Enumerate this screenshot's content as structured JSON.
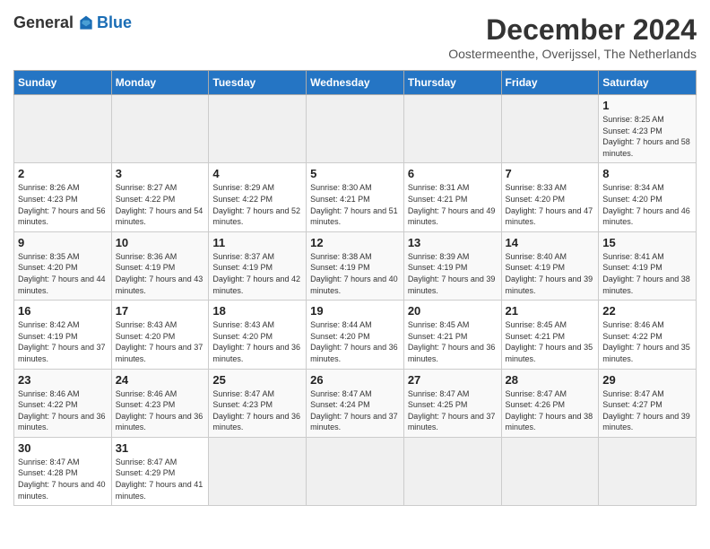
{
  "header": {
    "logo": {
      "general": "General",
      "blue": "Blue"
    },
    "title": "December 2024",
    "location": "Oostermeenthe, Overijssel, The Netherlands"
  },
  "calendar": {
    "days_of_week": [
      "Sunday",
      "Monday",
      "Tuesday",
      "Wednesday",
      "Thursday",
      "Friday",
      "Saturday"
    ],
    "weeks": [
      [
        {
          "day": "",
          "empty": true
        },
        {
          "day": "",
          "empty": true
        },
        {
          "day": "",
          "empty": true
        },
        {
          "day": "",
          "empty": true
        },
        {
          "day": "",
          "empty": true
        },
        {
          "day": "",
          "empty": true
        },
        {
          "day": "",
          "empty": true
        }
      ],
      [
        {
          "day": "1",
          "sunrise": "8:25 AM",
          "sunset": "4:23 PM",
          "daylight": "7 hours and 58 minutes."
        },
        {
          "day": "2",
          "sunrise": "8:26 AM",
          "sunset": "4:23 PM",
          "daylight": "7 hours and 56 minutes."
        },
        {
          "day": "3",
          "sunrise": "8:27 AM",
          "sunset": "4:22 PM",
          "daylight": "7 hours and 54 minutes."
        },
        {
          "day": "4",
          "sunrise": "8:29 AM",
          "sunset": "4:22 PM",
          "daylight": "7 hours and 52 minutes."
        },
        {
          "day": "5",
          "sunrise": "8:30 AM",
          "sunset": "4:21 PM",
          "daylight": "7 hours and 51 minutes."
        },
        {
          "day": "6",
          "sunrise": "8:31 AM",
          "sunset": "4:21 PM",
          "daylight": "7 hours and 49 minutes."
        },
        {
          "day": "7",
          "sunrise": "8:33 AM",
          "sunset": "4:20 PM",
          "daylight": "7 hours and 47 minutes."
        }
      ],
      [
        {
          "day": "8",
          "sunrise": "8:34 AM",
          "sunset": "4:20 PM",
          "daylight": "7 hours and 46 minutes."
        },
        {
          "day": "9",
          "sunrise": "8:35 AM",
          "sunset": "4:20 PM",
          "daylight": "7 hours and 44 minutes."
        },
        {
          "day": "10",
          "sunrise": "8:36 AM",
          "sunset": "4:19 PM",
          "daylight": "7 hours and 43 minutes."
        },
        {
          "day": "11",
          "sunrise": "8:37 AM",
          "sunset": "4:19 PM",
          "daylight": "7 hours and 42 minutes."
        },
        {
          "day": "12",
          "sunrise": "8:38 AM",
          "sunset": "4:19 PM",
          "daylight": "7 hours and 40 minutes."
        },
        {
          "day": "13",
          "sunrise": "8:39 AM",
          "sunset": "4:19 PM",
          "daylight": "7 hours and 39 minutes."
        },
        {
          "day": "14",
          "sunrise": "8:40 AM",
          "sunset": "4:19 PM",
          "daylight": "7 hours and 39 minutes."
        }
      ],
      [
        {
          "day": "15",
          "sunrise": "8:41 AM",
          "sunset": "4:19 PM",
          "daylight": "7 hours and 38 minutes."
        },
        {
          "day": "16",
          "sunrise": "8:42 AM",
          "sunset": "4:19 PM",
          "daylight": "7 hours and 37 minutes."
        },
        {
          "day": "17",
          "sunrise": "8:43 AM",
          "sunset": "4:20 PM",
          "daylight": "7 hours and 37 minutes."
        },
        {
          "day": "18",
          "sunrise": "8:43 AM",
          "sunset": "4:20 PM",
          "daylight": "7 hours and 36 minutes."
        },
        {
          "day": "19",
          "sunrise": "8:44 AM",
          "sunset": "4:20 PM",
          "daylight": "7 hours and 36 minutes."
        },
        {
          "day": "20",
          "sunrise": "8:45 AM",
          "sunset": "4:21 PM",
          "daylight": "7 hours and 36 minutes."
        },
        {
          "day": "21",
          "sunrise": "8:45 AM",
          "sunset": "4:21 PM",
          "daylight": "7 hours and 35 minutes."
        }
      ],
      [
        {
          "day": "22",
          "sunrise": "8:46 AM",
          "sunset": "4:22 PM",
          "daylight": "7 hours and 35 minutes."
        },
        {
          "day": "23",
          "sunrise": "8:46 AM",
          "sunset": "4:22 PM",
          "daylight": "7 hours and 36 minutes."
        },
        {
          "day": "24",
          "sunrise": "8:46 AM",
          "sunset": "4:23 PM",
          "daylight": "7 hours and 36 minutes."
        },
        {
          "day": "25",
          "sunrise": "8:47 AM",
          "sunset": "4:23 PM",
          "daylight": "7 hours and 36 minutes."
        },
        {
          "day": "26",
          "sunrise": "8:47 AM",
          "sunset": "4:24 PM",
          "daylight": "7 hours and 37 minutes."
        },
        {
          "day": "27",
          "sunrise": "8:47 AM",
          "sunset": "4:25 PM",
          "daylight": "7 hours and 37 minutes."
        },
        {
          "day": "28",
          "sunrise": "8:47 AM",
          "sunset": "4:26 PM",
          "daylight": "7 hours and 38 minutes."
        }
      ],
      [
        {
          "day": "29",
          "sunrise": "8:47 AM",
          "sunset": "4:27 PM",
          "daylight": "7 hours and 39 minutes."
        },
        {
          "day": "30",
          "sunrise": "8:47 AM",
          "sunset": "4:28 PM",
          "daylight": "7 hours and 40 minutes."
        },
        {
          "day": "31",
          "sunrise": "8:47 AM",
          "sunset": "4:29 PM",
          "daylight": "7 hours and 41 minutes."
        },
        {
          "day": "",
          "empty": true
        },
        {
          "day": "",
          "empty": true
        },
        {
          "day": "",
          "empty": true
        },
        {
          "day": "",
          "empty": true
        }
      ]
    ]
  }
}
